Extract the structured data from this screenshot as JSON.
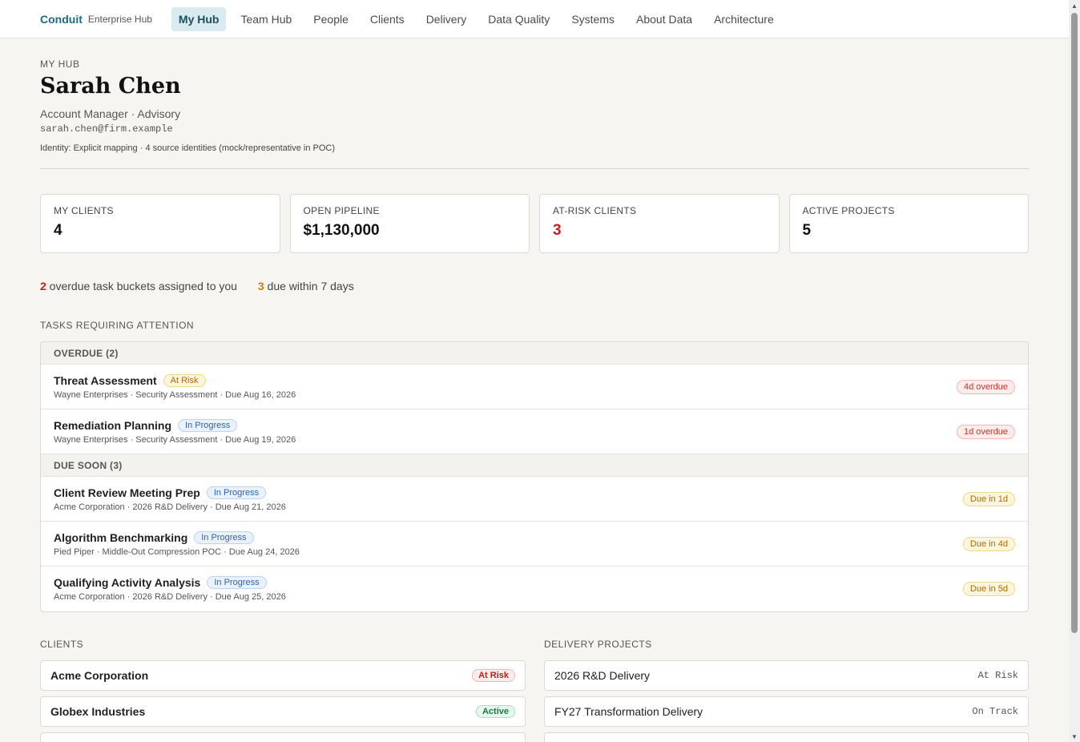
{
  "nav": {
    "brand": "Conduit",
    "brand_sub": "Enterprise Hub",
    "tabs": [
      {
        "label": "My Hub"
      },
      {
        "label": "Team Hub"
      },
      {
        "label": "People"
      },
      {
        "label": "Clients"
      },
      {
        "label": "Delivery"
      },
      {
        "label": "Data Quality"
      },
      {
        "label": "Systems"
      },
      {
        "label": "About Data"
      },
      {
        "label": "Architecture"
      }
    ],
    "active_tab": "My Hub"
  },
  "header": {
    "eyebrow": "MY HUB",
    "name": "Sarah Chen",
    "role": "Account Manager · Advisory",
    "email": "sarah.chen@firm.example",
    "identity": "Identity: Explicit mapping · 4 source identities (mock/representative in POC)"
  },
  "kpis": [
    {
      "label": "MY CLIENTS",
      "value": "4"
    },
    {
      "label": "OPEN PIPELINE",
      "value": "$1,130,000"
    },
    {
      "label": "AT-RISK CLIENTS",
      "value": "3"
    },
    {
      "label": "ACTIVE PROJECTS",
      "value": "5"
    }
  ],
  "alerts": {
    "overdue_count": "2",
    "overdue_text": " overdue task buckets assigned to you",
    "soon_count": "3",
    "soon_text": " due within 7 days"
  },
  "tasks": {
    "title": "TASKS REQUIRING ATTENTION",
    "overdue_header": "OVERDUE (2)",
    "due_soon_header": "DUE SOON (3)",
    "overdue": [
      {
        "name": "Threat Assessment",
        "status": "At Risk",
        "meta": "Wayne Enterprises · Security Assessment · Due Aug 16, 2026",
        "due": "4d overdue"
      },
      {
        "name": "Remediation Planning",
        "status": "In Progress",
        "meta": "Wayne Enterprises · Security Assessment · Due Aug 19, 2026",
        "due": "1d overdue"
      }
    ],
    "due_soon": [
      {
        "name": "Client Review Meeting Prep",
        "status": "In Progress",
        "meta": "Acme Corporation · 2026 R&D Delivery · Due Aug 21, 2026",
        "due": "Due in 1d"
      },
      {
        "name": "Algorithm Benchmarking",
        "status": "In Progress",
        "meta": "Pied Piper · Middle-Out Compression POC · Due Aug 24, 2026",
        "due": "Due in 4d"
      },
      {
        "name": "Qualifying Activity Analysis",
        "status": "In Progress",
        "meta": "Acme Corporation · 2026 R&D Delivery · Due Aug 25, 2026",
        "due": "Due in 5d"
      }
    ]
  },
  "clients": {
    "title": "CLIENTS",
    "items": [
      {
        "name": "Acme Corporation",
        "status": "At Risk"
      },
      {
        "name": "Globex Industries",
        "status": "Active"
      }
    ]
  },
  "projects": {
    "title": "DELIVERY PROJECTS",
    "items": [
      {
        "name": "2026 R&D Delivery",
        "status": "At Risk"
      },
      {
        "name": "FY27 Transformation Delivery",
        "status": "On Track"
      }
    ]
  }
}
